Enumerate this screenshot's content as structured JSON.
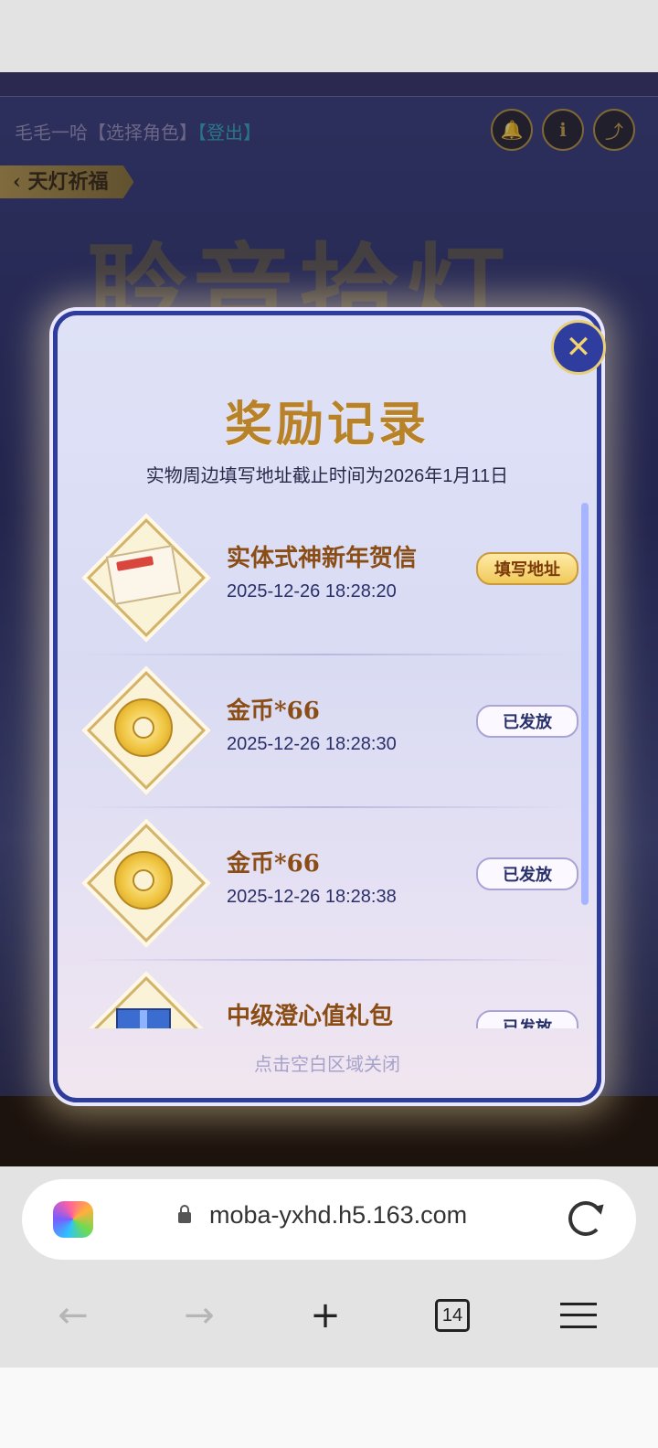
{
  "header": {
    "user_name": "毛毛一哈",
    "choose_role": "【选择角色】",
    "logout": "【登出】",
    "icons": [
      "bell-icon",
      "info-icon",
      "share-icon"
    ]
  },
  "back_tag": {
    "label": "天灯祈福"
  },
  "background_title": "聆音拾灯",
  "modal": {
    "title": "奖励记录",
    "subtitle": "实物周边填写地址截止时间为2026年1月11日",
    "close_hint": "点击空白区域关闭",
    "records": [
      {
        "name": "实体式神新年贺信",
        "time": "2025-12-26 18:28:20",
        "button": "填写地址",
        "icon": "envelope-icon"
      },
      {
        "name": "金币*66",
        "time": "2025-12-26 18:28:30",
        "button": "已发放",
        "icon": "coin-icon"
      },
      {
        "name": "金币*66",
        "time": "2025-12-26 18:28:38",
        "button": "已发放",
        "icon": "coin-icon"
      },
      {
        "name": "中级澄心值礼包",
        "time": "",
        "button": "已发放",
        "icon": "gift-icon"
      }
    ]
  },
  "browser": {
    "url": "moba-yxhd.h5.163.com",
    "tab_count": "14"
  },
  "colors": {
    "title_gold": "#b8822a",
    "frame_blue": "#2e3c9c",
    "item_name": "#8a4d16"
  }
}
